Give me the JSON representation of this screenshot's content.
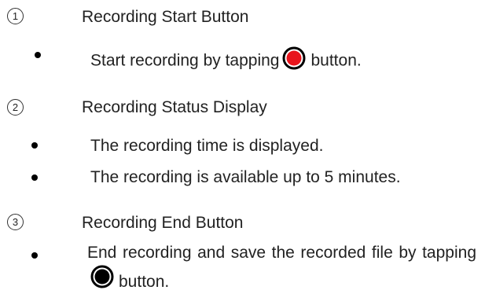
{
  "sections": [
    {
      "number": "1",
      "title": "Recording Start Button",
      "bullets": [
        {
          "before": "Start recording by tapping",
          "icon": "record-start-icon",
          "after": "button."
        }
      ]
    },
    {
      "number": "2",
      "title": "Recording Status Display",
      "bullets": [
        {
          "text": "The recording time is displayed."
        },
        {
          "text": "The recording is available up to 5 minutes."
        }
      ]
    },
    {
      "number": "3",
      "title": "Recording End Button",
      "bullets": [
        {
          "before": "End recording and save the recorded file by tapping",
          "icon": "record-stop-icon",
          "after": "button."
        }
      ]
    }
  ],
  "colors": {
    "record_start_fill": "#e8141c",
    "record_start_ring": "#000000",
    "record_stop_fill": "#000000",
    "text": "#222222"
  }
}
